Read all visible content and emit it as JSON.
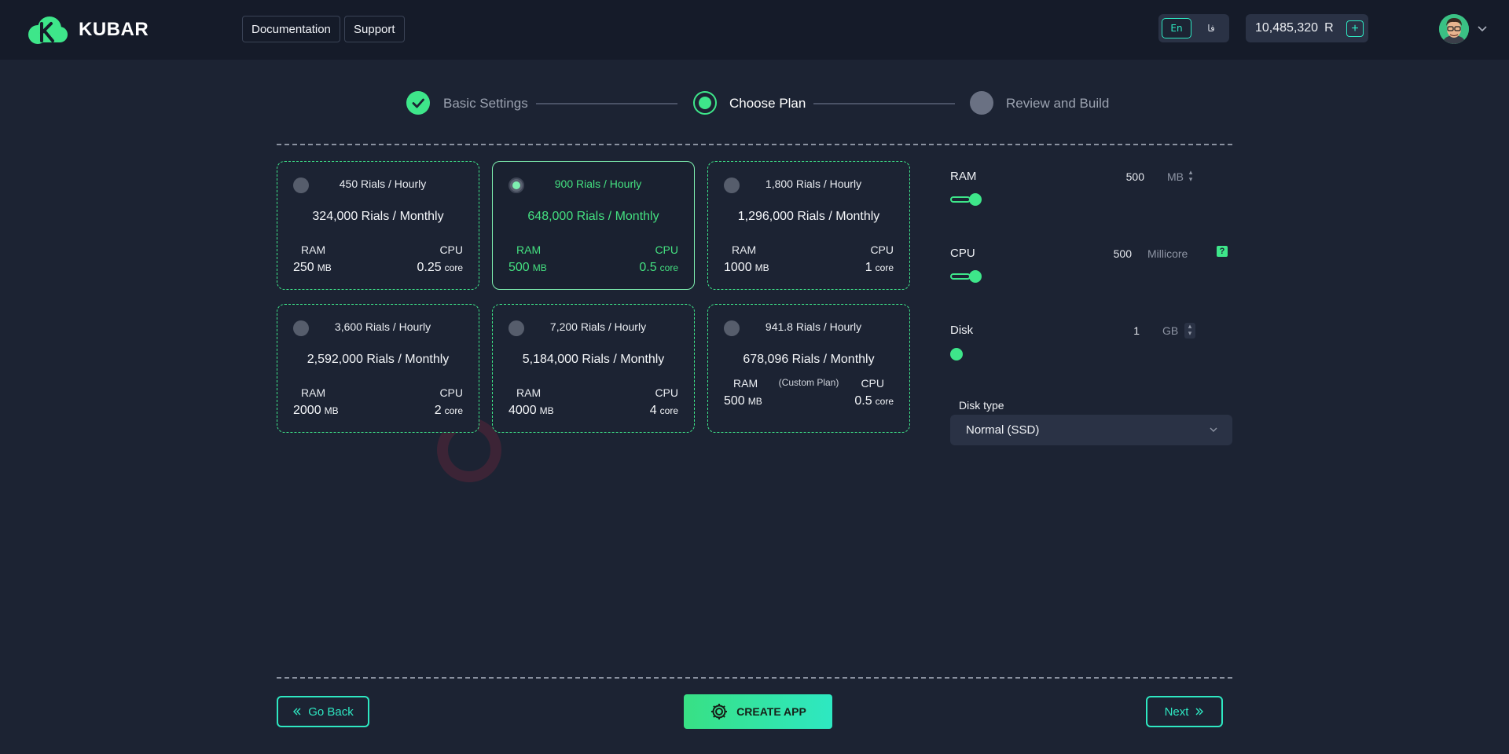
{
  "header": {
    "brand": "KUBAR",
    "nav": [
      "Documentation",
      "Support"
    ],
    "languages": [
      {
        "label": "En",
        "active": true
      },
      {
        "label": "فا",
        "active": false
      }
    ],
    "balance": {
      "amount": "10,485,320",
      "currency": "R",
      "add_label": "+"
    }
  },
  "stepper": {
    "steps": [
      {
        "label": "Basic Settings",
        "state": "done"
      },
      {
        "label": "Choose Plan",
        "state": "current"
      },
      {
        "label": "Review and Build",
        "state": "pending"
      }
    ]
  },
  "plans": [
    {
      "hourly": "450 Rials / Hourly",
      "monthly": "324,000 Rials / Monthly",
      "ram_label": "RAM",
      "ram_value": "250",
      "ram_unit": "MB",
      "cpu_label": "CPU",
      "cpu_value": "0.25",
      "cpu_unit": "core",
      "selected": false
    },
    {
      "hourly": "900 Rials / Hourly",
      "monthly": "648,000 Rials / Monthly",
      "ram_label": "RAM",
      "ram_value": "500",
      "ram_unit": "MB",
      "cpu_label": "CPU",
      "cpu_value": "0.5",
      "cpu_unit": "core",
      "selected": true
    },
    {
      "hourly": "1,800 Rials / Hourly",
      "monthly": "1,296,000 Rials / Monthly",
      "ram_label": "RAM",
      "ram_value": "1000",
      "ram_unit": "MB",
      "cpu_label": "CPU",
      "cpu_value": "1",
      "cpu_unit": "core",
      "selected": false
    },
    {
      "hourly": "3,600 Rials / Hourly",
      "monthly": "2,592,000 Rials / Monthly",
      "ram_label": "RAM",
      "ram_value": "2000",
      "ram_unit": "MB",
      "cpu_label": "CPU",
      "cpu_value": "2",
      "cpu_unit": "core",
      "selected": false
    },
    {
      "hourly": "7,200 Rials / Hourly",
      "monthly": "5,184,000 Rials / Monthly",
      "ram_label": "RAM",
      "ram_value": "4000",
      "ram_unit": "MB",
      "cpu_label": "CPU",
      "cpu_value": "4",
      "cpu_unit": "core",
      "selected": false
    },
    {
      "hourly": "941.8 Rials / Hourly",
      "monthly": "678,096 Rials / Monthly",
      "tag": "(Custom Plan)",
      "ram_label": "RAM",
      "ram_value": "500",
      "ram_unit": "MB",
      "cpu_label": "CPU",
      "cpu_value": "0.5",
      "cpu_unit": "core",
      "selected": false
    }
  ],
  "custom": {
    "ram": {
      "label": "RAM",
      "value": "500",
      "unit": "MB",
      "level": 0.02
    },
    "cpu": {
      "label": "CPU",
      "value": "500",
      "unit": "Millicore",
      "level": 0.02,
      "help": "?"
    },
    "disk": {
      "label": "Disk",
      "value": "1",
      "unit": "GB",
      "level": 0.0
    },
    "disk_type": {
      "label": "Disk type",
      "selected": "Normal (SSD)"
    }
  },
  "footer": {
    "back_label": "Go Back",
    "create_label": "CREATE APP",
    "next_label": "Next"
  },
  "colors": {
    "accent_green": "#3ee68a",
    "accent_teal": "#2ee8c2",
    "background": "#1c2333",
    "header_bg": "#151b29",
    "surface": "#2a3245"
  }
}
